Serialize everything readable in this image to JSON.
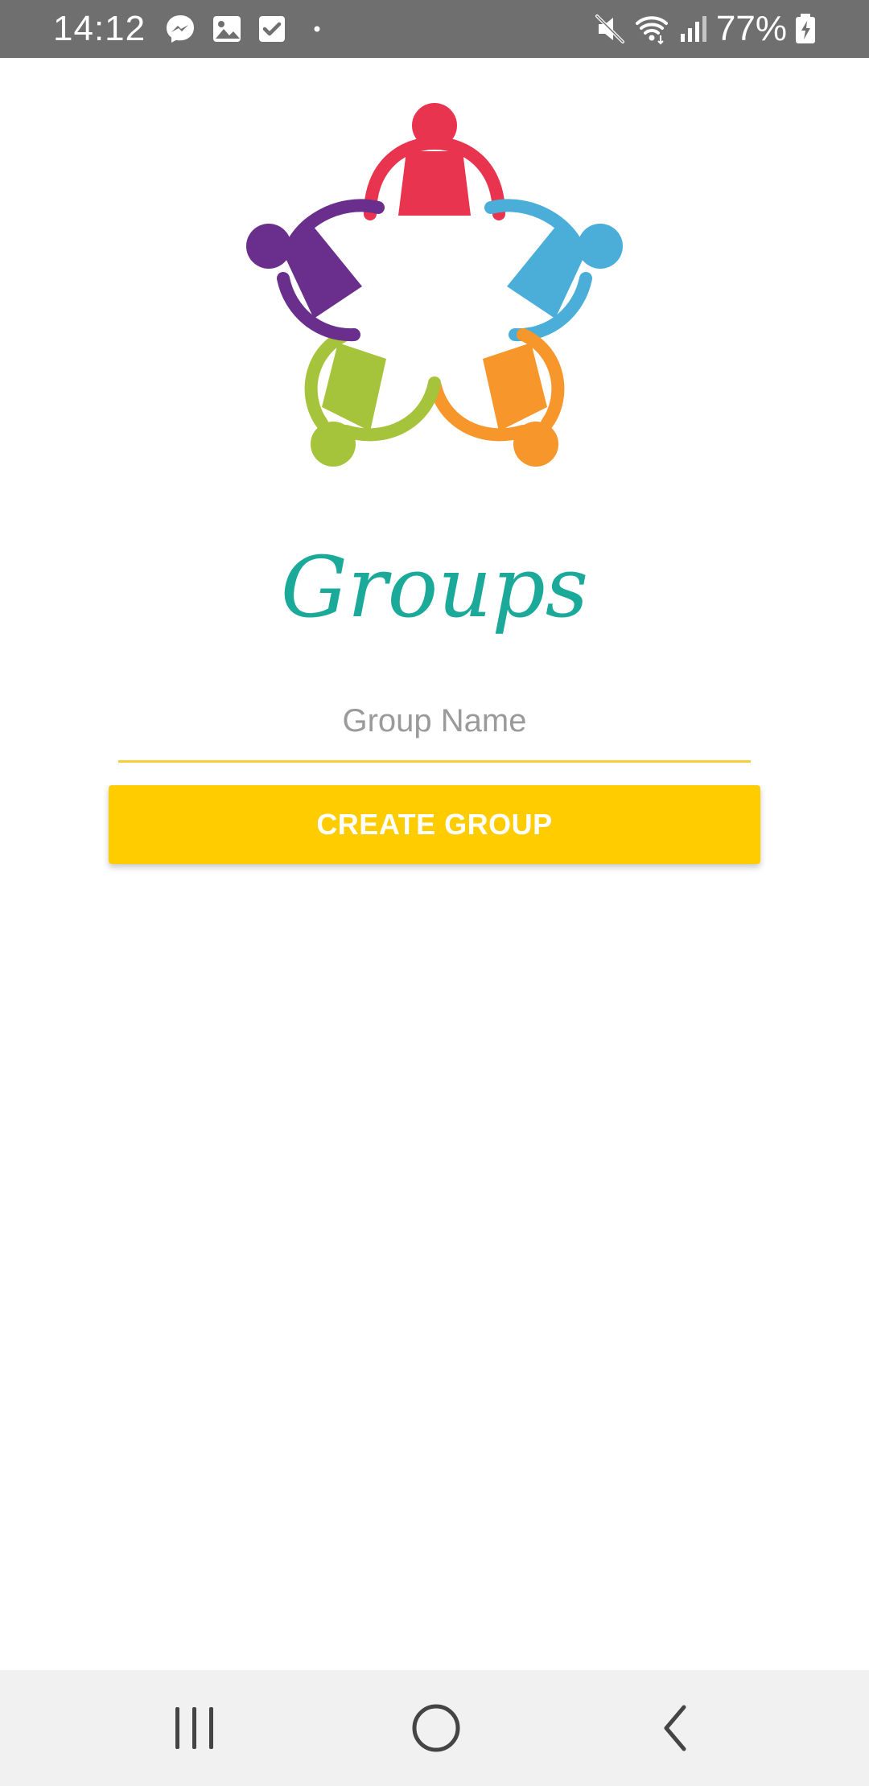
{
  "status_bar": {
    "time": "14:12",
    "battery_percent": "77%",
    "icons": [
      "messenger-icon",
      "gallery-icon",
      "checkbox-icon",
      "dot-icon",
      "mute-icon",
      "wifi-icon",
      "signal-icon",
      "battery-icon"
    ]
  },
  "logo": {
    "name": "people-circle-logo",
    "colors": [
      "#e8344e",
      "#4aaed8",
      "#f7962b",
      "#a6c43b",
      "#6a2f8c"
    ]
  },
  "title": "Groups",
  "form": {
    "group_name_placeholder": "Group Name",
    "group_name_value": "",
    "create_button_label": "CREATE GROUP"
  },
  "colors": {
    "accent": "#ffcc00",
    "title": "#1ba99a",
    "underline": "#f6cf3a"
  },
  "nav_bar": {
    "buttons": [
      "recents-icon",
      "home-icon",
      "back-icon"
    ]
  }
}
